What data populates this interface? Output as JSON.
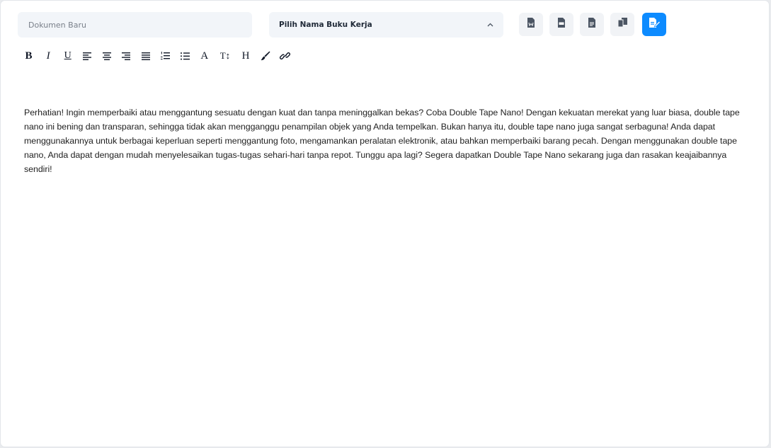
{
  "doc_name": {
    "placeholder": "Dokumen Baru",
    "value": ""
  },
  "workbook_select": {
    "label": "Pilih Nama Buku Kerja",
    "chevron_icon": "chevron-up-icon"
  },
  "actions": [
    {
      "name": "export-word-button",
      "icon": "word-file-icon"
    },
    {
      "name": "export-pdf-button",
      "icon": "pdf-file-icon"
    },
    {
      "name": "export-text-button",
      "icon": "text-file-icon"
    },
    {
      "name": "copy-button",
      "icon": "copy-icon"
    },
    {
      "name": "save-button",
      "icon": "file-edit-icon",
      "color": "#0d8bff"
    }
  ],
  "toolbar": {
    "bold": "B",
    "italic": "I",
    "underline": "U",
    "align_left_icon": "align-left-icon",
    "align_center_icon": "align-center-icon",
    "align_right_icon": "align-right-icon",
    "align_justify_icon": "align-justify-icon",
    "ordered_list_icon": "ordered-list-icon",
    "bullet_list_icon": "bullet-list-icon",
    "font_color": "A",
    "text_size": "T↕",
    "heading": "H",
    "brush_icon": "brush-icon",
    "link_icon": "link-icon"
  },
  "content": "Perhatian! Ingin memperbaiki atau menggantung sesuatu dengan kuat dan tanpa meninggalkan bekas? Coba Double Tape Nano! Dengan kekuatan merekat yang luar biasa, double tape nano ini bening dan transparan, sehingga tidak akan mengganggu penampilan objek yang Anda tempelkan. Bukan hanya itu, double tape nano juga sangat serbaguna! Anda dapat menggunakannya untuk berbagai keperluan seperti menggantung foto, mengamankan peralatan elektronik, atau bahkan memperbaiki barang pecah. Dengan menggunakan double tape nano, Anda dapat dengan mudah menyelesaikan tugas-tugas sehari-hari tanpa repot. Tunggu apa lagi? Segera dapatkan Double Tape Nano sekarang juga dan rasakan keajaibannya sendiri!",
  "colors": {
    "accent": "#0d8bff",
    "field_bg": "#f2f5f9",
    "button_bg": "#f1f3f6"
  }
}
